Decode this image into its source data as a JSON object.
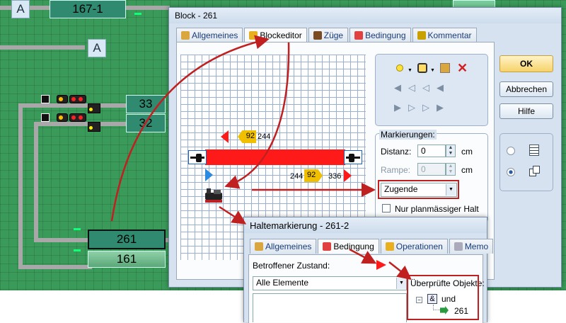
{
  "layout": {
    "a_label_top": "A",
    "a_label_mid": "A",
    "block_167": "167-1",
    "block_33": "33",
    "block_32": "32",
    "block_261": "261",
    "block_161": "161"
  },
  "block_dialog": {
    "title": "Block - 261",
    "tabs": [
      "Allgemeines",
      "Blockeditor",
      "Züge",
      "Bedingung",
      "Kommentar"
    ],
    "editor": {
      "marker_top_speed": "92",
      "marker_top_distance": "244",
      "marker_bottom_left_distance": "244",
      "marker_bottom_speed": "92",
      "marker_bottom_right_distance": "336"
    },
    "markierungen_label": "Markierungen:",
    "distanz_label": "Distanz:",
    "distanz_value": "0",
    "distanz_unit": "cm",
    "rampe_label": "Rampe:",
    "rampe_value": "0",
    "rampe_unit": "cm",
    "train_type_value": "Zugende",
    "halt_checkbox_label": "Nur planmässiger Halt",
    "ok_label": "OK",
    "cancel_label": "Abbrechen",
    "help_label": "Hilfe"
  },
  "halt_dialog": {
    "title": "Haltemarkierung - 261-2",
    "tabs": [
      "Allgemeines",
      "Bedingung",
      "Operationen",
      "Memo"
    ],
    "zustand_label": "Betroffener Zustand:",
    "zustand_value": "Alle Elemente",
    "objects_label": "Überprüfte Objekte:",
    "tree_root_symbol": "&",
    "tree_root": "und",
    "tree_child": "261"
  },
  "colors": {
    "accent_red": "#c02020",
    "block_red": "#ff1a1a",
    "marker_yellow": "#f0c000",
    "marker_blue": "#2a8ae0",
    "layout_green": "#3a9a5a"
  },
  "icons": [
    "circle-icon",
    "route-icon",
    "properties-icon",
    "delete-icon",
    "step-left-icon",
    "step-right-icon",
    "list-icon",
    "copy-icon"
  ]
}
